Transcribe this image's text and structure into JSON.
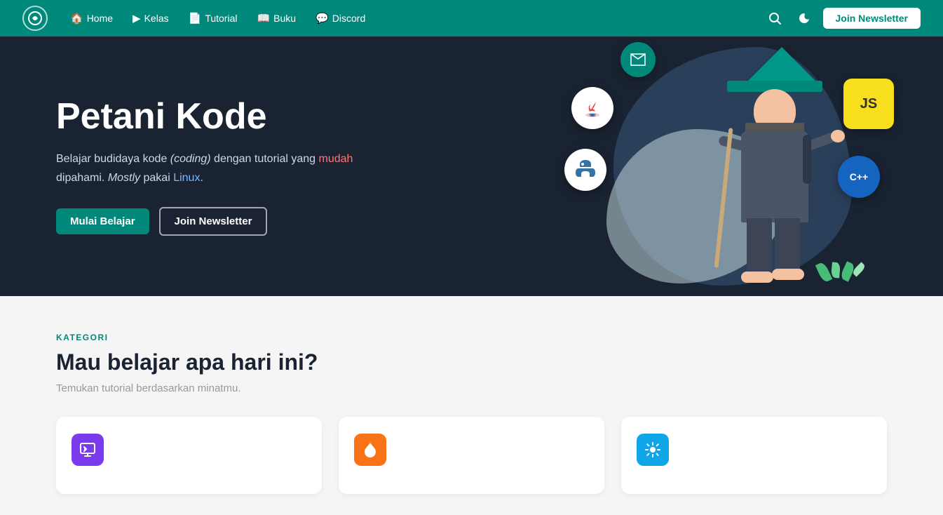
{
  "navbar": {
    "logo_symbol": "✦",
    "links": [
      {
        "label": "Home",
        "icon": "🏠",
        "name": "home"
      },
      {
        "label": "Kelas",
        "icon": "▶",
        "name": "kelas"
      },
      {
        "label": "Tutorial",
        "icon": "📄",
        "name": "tutorial"
      },
      {
        "label": "Buku",
        "icon": "📖",
        "name": "buku"
      },
      {
        "label": "Discord",
        "icon": "💬",
        "name": "discord"
      }
    ],
    "join_newsletter": "Join Newsletter",
    "search_title": "Search",
    "theme_title": "Toggle theme"
  },
  "hero": {
    "title": "Petani Kode",
    "description_part1": "Belajar budidaya kode ",
    "description_coding": "(coding)",
    "description_part2": " dengan tutorial yang ",
    "description_mudah": "mudah",
    "description_part3": "\ndipahami. ",
    "description_mostly": "Mostly",
    "description_part4": " pakai ",
    "description_linux": "Linux",
    "description_part5": ".",
    "btn_start": "Mulai Belajar",
    "btn_newsletter": "Join Newsletter"
  },
  "categories": {
    "tag": "KATEGORI",
    "title": "Mau belajar apa hari ini?",
    "subtitle": "Temukan tutorial berdasarkan minatmu.",
    "cards": [
      {
        "icon": "⌨",
        "color": "purple"
      },
      {
        "icon": "🔥",
        "color": "orange"
      },
      {
        "icon": "💡",
        "color": "blue"
      }
    ]
  },
  "tech_icons": {
    "java": "☕",
    "python": "🐍",
    "js": "JS",
    "cpp": "C++",
    "paper": "✉"
  },
  "colors": {
    "teal": "#00897B",
    "dark_navy": "#1a2332",
    "light_blue": "#d0e8e8"
  }
}
